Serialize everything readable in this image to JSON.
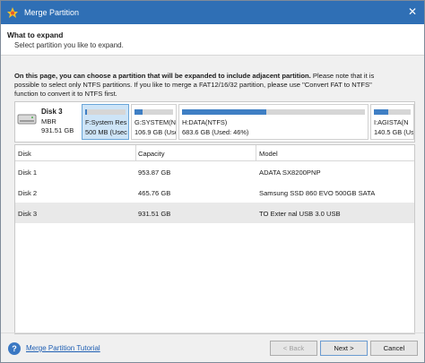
{
  "window": {
    "title": "Merge Partition",
    "close_glyph": "✕"
  },
  "header": {
    "title": "What to expand",
    "subtitle": "Select partition you like to expand."
  },
  "description": {
    "bold": "On this page, you can choose a partition that will be expanded to include adjacent partition.",
    "line1_rest": " Please note that it is",
    "line2": "possible to select only NTFS partitions. If you like to merge a FAT12/16/32 partition, please use \"Convert FAT to NTFS\"",
    "line3": "function to convert it to NTFS first."
  },
  "disk_map": {
    "name": "Disk 3",
    "type": "MBR",
    "size": "931.51 GB",
    "partitions": [
      {
        "label": "F:System Res",
        "detail": "500 MB (Usec",
        "used": 0.05,
        "selected": true
      },
      {
        "label": "G:SYSTEM(N",
        "detail": "106.9 GB (Use",
        "used": 0.2,
        "selected": false
      },
      {
        "label": "H:DATA(NTFS)",
        "detail": "683.6 GB (Used: 46%)",
        "used": 0.46,
        "selected": false
      },
      {
        "label": "I:AGISTA(N",
        "detail": "140.5 GB (Use",
        "used": 0.4,
        "selected": false
      }
    ]
  },
  "table": {
    "columns": [
      "Disk",
      "Capacity",
      "Model"
    ],
    "rows": [
      {
        "disk": "Disk 1",
        "capacity": "953.87 GB",
        "model": "ADATA SX8200PNP",
        "selected": false
      },
      {
        "disk": "Disk 2",
        "capacity": "465.76 GB",
        "model": "Samsung SSD 860 EVO 500GB SATA",
        "selected": false
      },
      {
        "disk": "Disk 3",
        "capacity": "931.51 GB",
        "model": "TO Exter nal USB 3.0 USB",
        "selected": true
      }
    ]
  },
  "footer": {
    "help_glyph": "?",
    "tutorial_link": "Merge Partition Tutorial",
    "back": "< Back",
    "next": "Next >",
    "cancel": "Cancel"
  },
  "colors": {
    "titlebar": "#2f6fb5",
    "accent": "#3f7fc4",
    "selected_partition": "#cde4f7",
    "link": "#1f5fb3"
  }
}
